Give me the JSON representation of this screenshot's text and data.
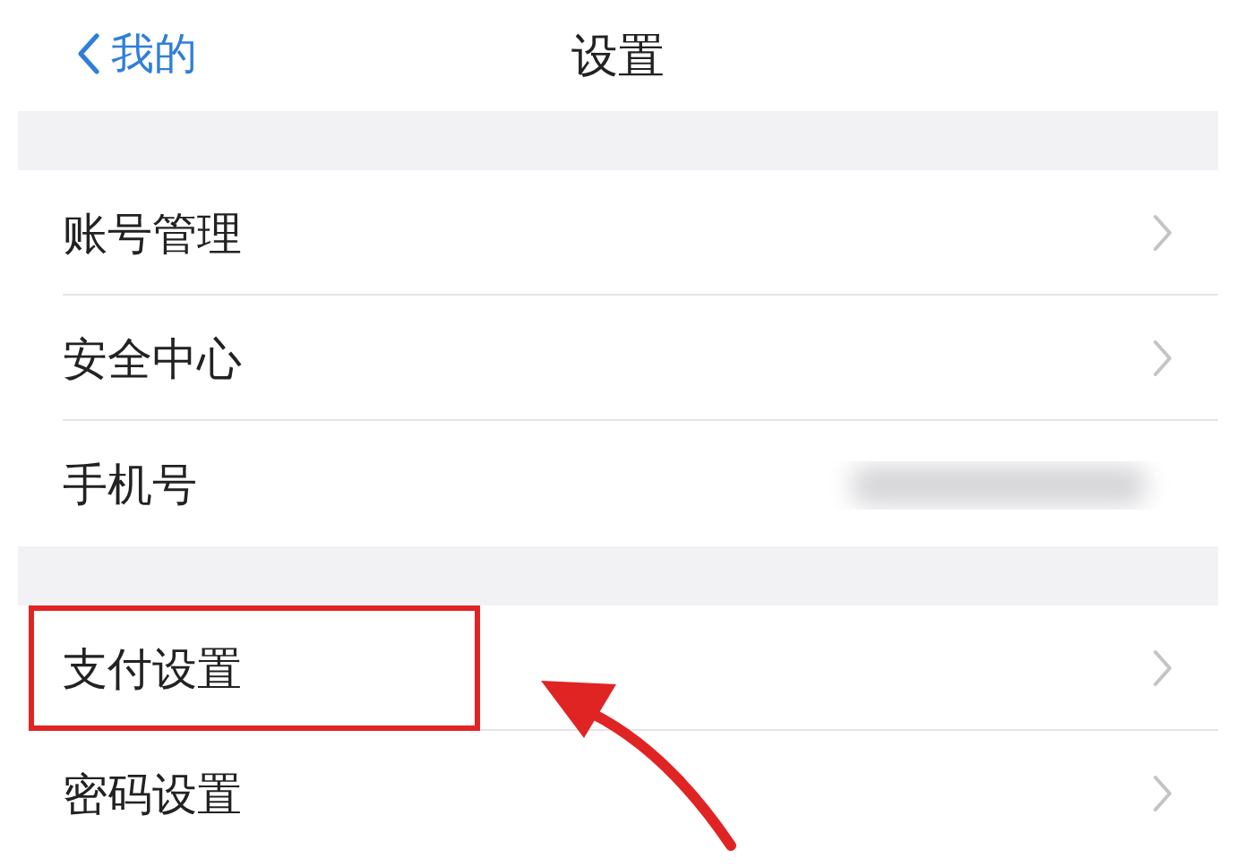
{
  "nav": {
    "back_label": "我的",
    "title": "设置"
  },
  "groups": [
    {
      "rows": [
        {
          "label": "账号管理",
          "kind": "link",
          "highlighted": false
        },
        {
          "label": "安全中心",
          "kind": "link",
          "highlighted": false
        },
        {
          "label": "手机号",
          "kind": "hidden_value",
          "highlighted": false
        }
      ]
    },
    {
      "rows": [
        {
          "label": "支付设置",
          "kind": "link",
          "highlighted": true
        },
        {
          "label": "密码设置",
          "kind": "link",
          "highlighted": false
        }
      ]
    }
  ]
}
